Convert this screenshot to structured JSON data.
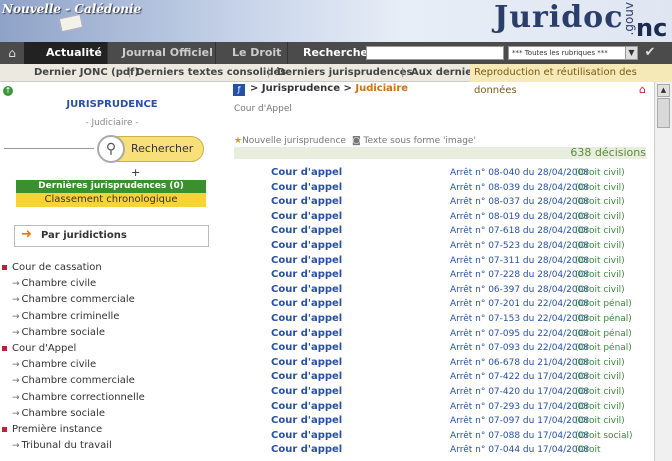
{
  "banner": {
    "region": "Nouvelle - Calédonie",
    "logo": "Juridoc",
    "gouv": ".gouv",
    "nc": "nc"
  },
  "nav": {
    "home_icon": "home-icon",
    "tabs": [
      "Actualité",
      "Journal Officiel",
      "Le Droit"
    ],
    "search_label": "Rechercher",
    "select_value": "*** Toutes les rubriques ***",
    "go_icon": "checkmark-icon"
  },
  "subnav": {
    "links": [
      "Dernier JONC (pdf)",
      "Derniers textes consolidés",
      "Derniers jurisprudences",
      "Aux derniers JONC"
    ],
    "separator": "|",
    "repro": "Reproduction et réutilisation des données"
  },
  "sidebar": {
    "title": "JURISPRUDENCE",
    "subtitle": "- Judiciaire -",
    "search_button": "Rechercher",
    "latest_button": "Dernières jurisprudences (0)",
    "classement_button": "Classement chronologique",
    "par_juridictions": "Par juridictions",
    "tree": [
      {
        "type": "cat",
        "label": "Cour de cassation"
      },
      {
        "type": "sub",
        "label": "Chambre civile"
      },
      {
        "type": "sub",
        "label": "Chambre commerciale"
      },
      {
        "type": "sub",
        "label": "Chambre criminelle"
      },
      {
        "type": "sub",
        "label": "Chambre sociale"
      },
      {
        "type": "cat",
        "label": "Cour d'Appel"
      },
      {
        "type": "sub",
        "label": "Chambre civile"
      },
      {
        "type": "sub",
        "label": "Chambre commerciale"
      },
      {
        "type": "sub",
        "label": "Chambre correctionnelle"
      },
      {
        "type": "sub",
        "label": "Chambre sociale"
      },
      {
        "type": "cat",
        "label": "Première instance"
      },
      {
        "type": "sub",
        "label": "Tribunal du travail"
      }
    ]
  },
  "content": {
    "breadcrumb_root": "Jurisprudence",
    "breadcrumb_sep": " > ",
    "breadcrumb_current": "Judiciaire",
    "section": "Cour d'Appel",
    "legend_new": "Nouvelle jurisprudence",
    "legend_image": "Texte sous forme 'image'",
    "count": "638 décisions",
    "rows": [
      {
        "court": "Cour d'appel",
        "arret": "Arrêt n° 08-040 du 28/04/2008",
        "domain": "(Droit civil)"
      },
      {
        "court": "Cour d'appel",
        "arret": "Arrêt n° 08-039 du 28/04/2008",
        "domain": "(Droit civil)"
      },
      {
        "court": "Cour d'appel",
        "arret": "Arrêt n° 08-037 du 28/04/2008",
        "domain": "(Droit civil)"
      },
      {
        "court": "Cour d'appel",
        "arret": "Arrêt n° 08-019 du 28/04/2008",
        "domain": "(Droit civil)"
      },
      {
        "court": "Cour d'appel",
        "arret": "Arrêt n° 07-618 du 28/04/2008",
        "domain": "(Droit civil)"
      },
      {
        "court": "Cour d'appel",
        "arret": "Arrêt n° 07-523 du 28/04/2008",
        "domain": "(Droit civil)"
      },
      {
        "court": "Cour d'appel",
        "arret": "Arrêt n° 07-311 du 28/04/2008",
        "domain": "(Droit civil)"
      },
      {
        "court": "Cour d'appel",
        "arret": "Arrêt n° 07-228 du 28/04/2008",
        "domain": "(Droit civil)"
      },
      {
        "court": "Cour d'appel",
        "arret": "Arrêt n° 06-397 du 28/04/2008",
        "domain": "(Droit civil)"
      },
      {
        "court": "Cour d'appel",
        "arret": "Arrêt n° 07-201 du 22/04/2008",
        "domain": "(Droit pénal)"
      },
      {
        "court": "Cour d'appel",
        "arret": "Arrêt n° 07-153 du 22/04/2008",
        "domain": "(Droit pénal)"
      },
      {
        "court": "Cour d'appel",
        "arret": "Arrêt n° 07-095 du 22/04/2008",
        "domain": "(Droit pénal)"
      },
      {
        "court": "Cour d'appel",
        "arret": "Arrêt n° 07-093 du 22/04/2008",
        "domain": "(Droit pénal)"
      },
      {
        "court": "Cour d'appel",
        "arret": "Arrêt n° 06-678 du 21/04/2008",
        "domain": "(Droit civil)"
      },
      {
        "court": "Cour d'appel",
        "arret": "Arrêt n° 07-422 du 17/04/2008",
        "domain": "(Droit civil)"
      },
      {
        "court": "Cour d'appel",
        "arret": "Arrêt n° 07-420 du 17/04/2008",
        "domain": "(Droit civil)"
      },
      {
        "court": "Cour d'appel",
        "arret": "Arrêt n° 07-293 du 17/04/2008",
        "domain": "(Droit civil)"
      },
      {
        "court": "Cour d'appel",
        "arret": "Arrêt n° 07-097 du 17/04/2008",
        "domain": "(Droit civil)"
      },
      {
        "court": "Cour d'appel",
        "arret": "Arrêt n° 07-088 du 17/04/2008",
        "domain": "(Droit social)"
      },
      {
        "court": "Cour d'appel",
        "arret": "Arrêt n° 07-044 du 17/04/2008",
        "domain": "(Droit"
      }
    ]
  }
}
